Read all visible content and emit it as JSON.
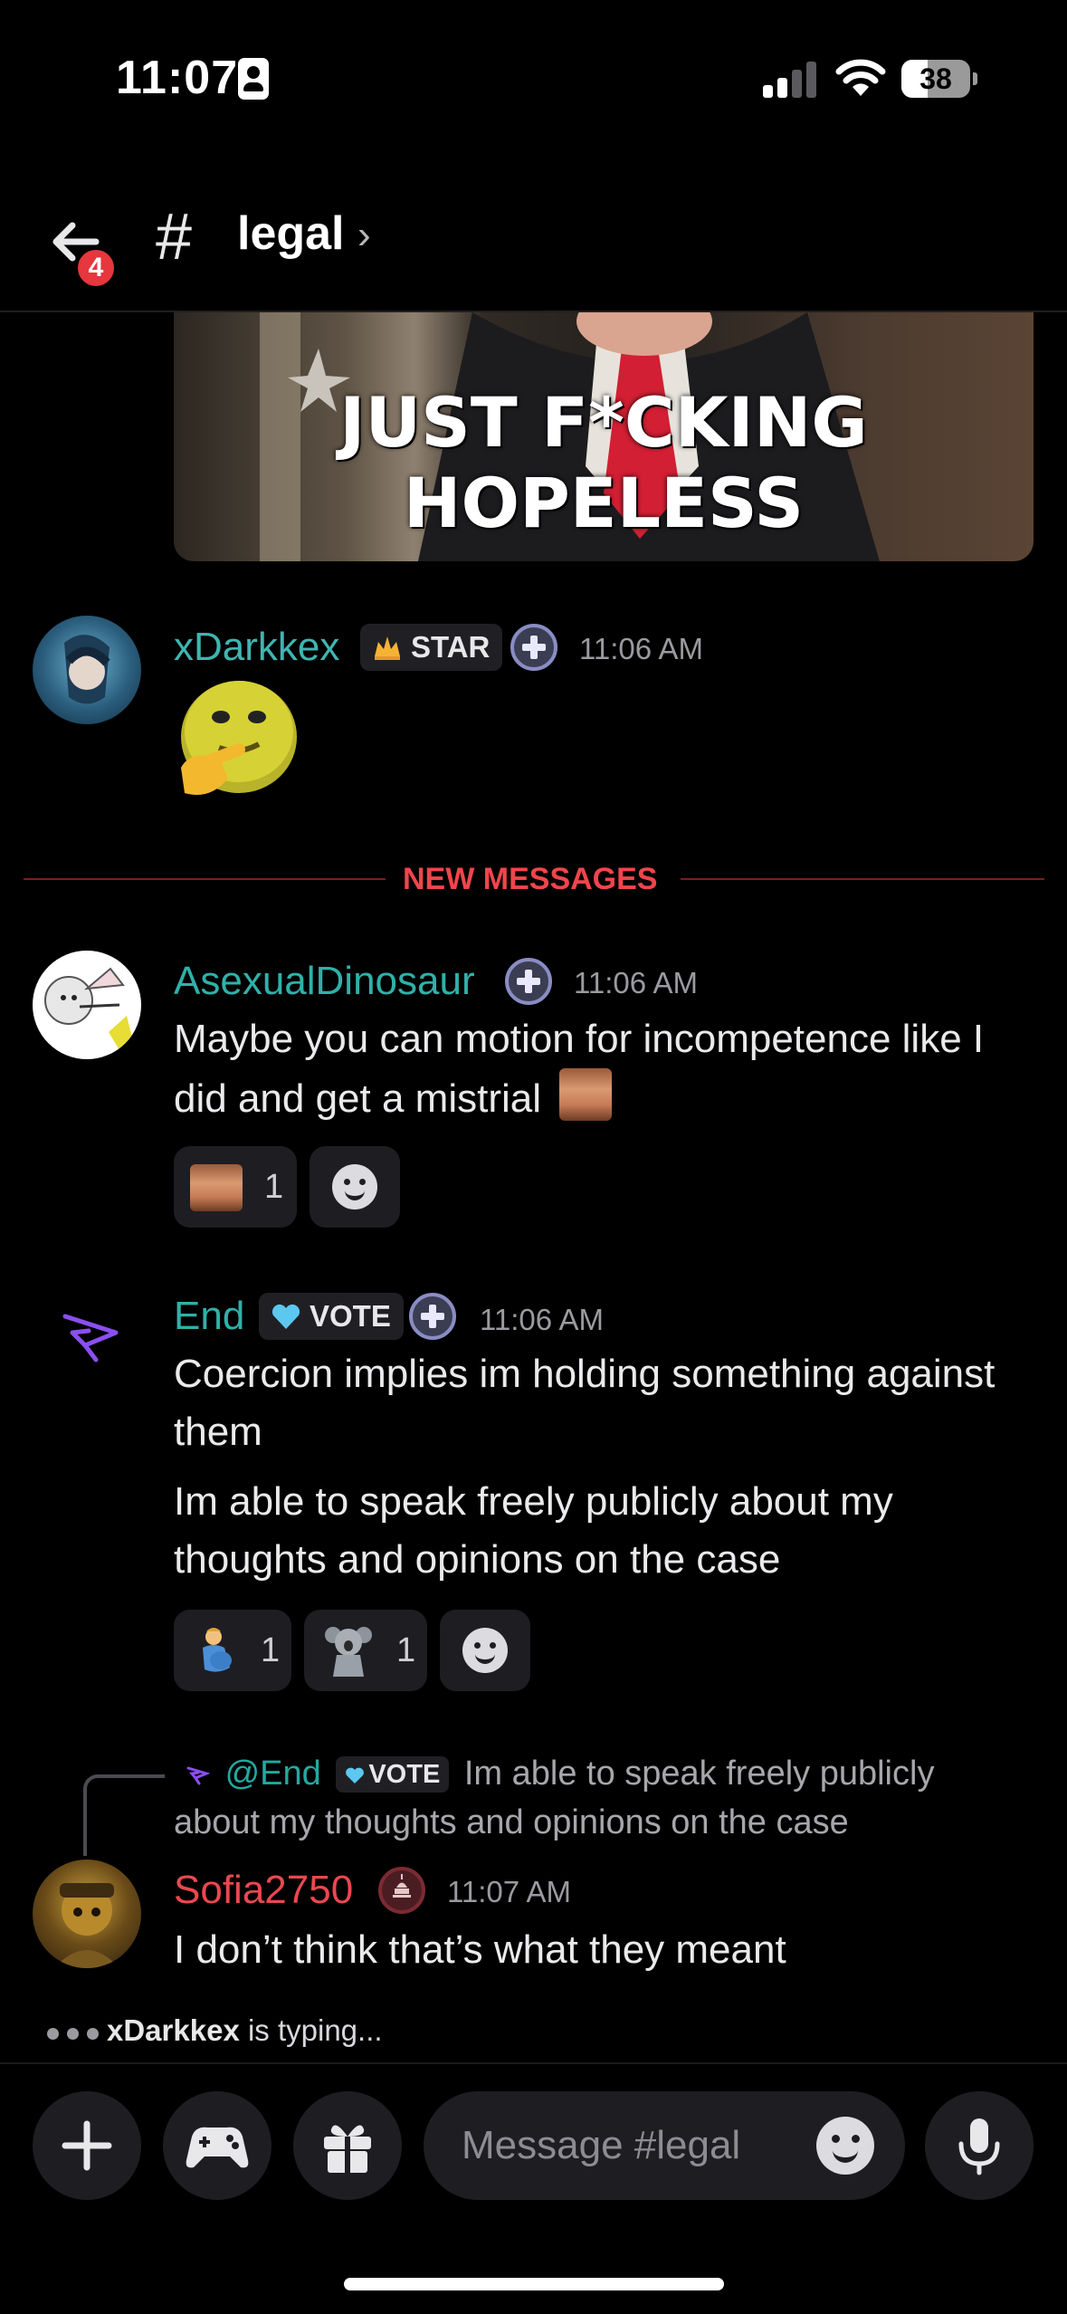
{
  "status_bar": {
    "time": "11:07",
    "battery": "38",
    "battery_level": 0.38
  },
  "header": {
    "back_badge": "4",
    "hash": "#",
    "channel_name": "legal",
    "chevron": "›"
  },
  "gif": {
    "caption": "JUST F*CKING HOPELESS"
  },
  "messages": [
    {
      "author": "xDarkkex",
      "author_color": "#3fb5b0",
      "role_tag": "STAR",
      "timestamp": "11:06 AM",
      "content": ""
    },
    {
      "author": "AsexualDinosaur",
      "author_color": "#2fb1a8",
      "timestamp": "11:06 AM",
      "content": "Maybe you can motion for incompetence like I did and get a mistrial",
      "reactions": [
        {
          "count": "1"
        }
      ]
    },
    {
      "author": "End",
      "author_color": "#2fb1a8",
      "role_tag": "VOTE",
      "timestamp": "11:06 AM",
      "content_lines": [
        "Coercion implies im holding something against them",
        "Im able to speak freely publicly about my thoughts and opinions on the case"
      ],
      "reactions": [
        {
          "count": "1"
        },
        {
          "count": "1"
        }
      ]
    },
    {
      "author": "Sofia2750",
      "author_color": "#e9484f",
      "timestamp": "11:07 AM",
      "content": "I don’t think that’s what they meant",
      "reply": {
        "mention": "@End",
        "role_tag": "VOTE",
        "text": "Im able to speak freely publicly about my thoughts and opinions on the case"
      }
    }
  ],
  "divider": {
    "label": "NEW MESSAGES"
  },
  "typing": {
    "user": "xDarkkex",
    "text": " is typing..."
  },
  "composer": {
    "placeholder": "Message #legal"
  }
}
